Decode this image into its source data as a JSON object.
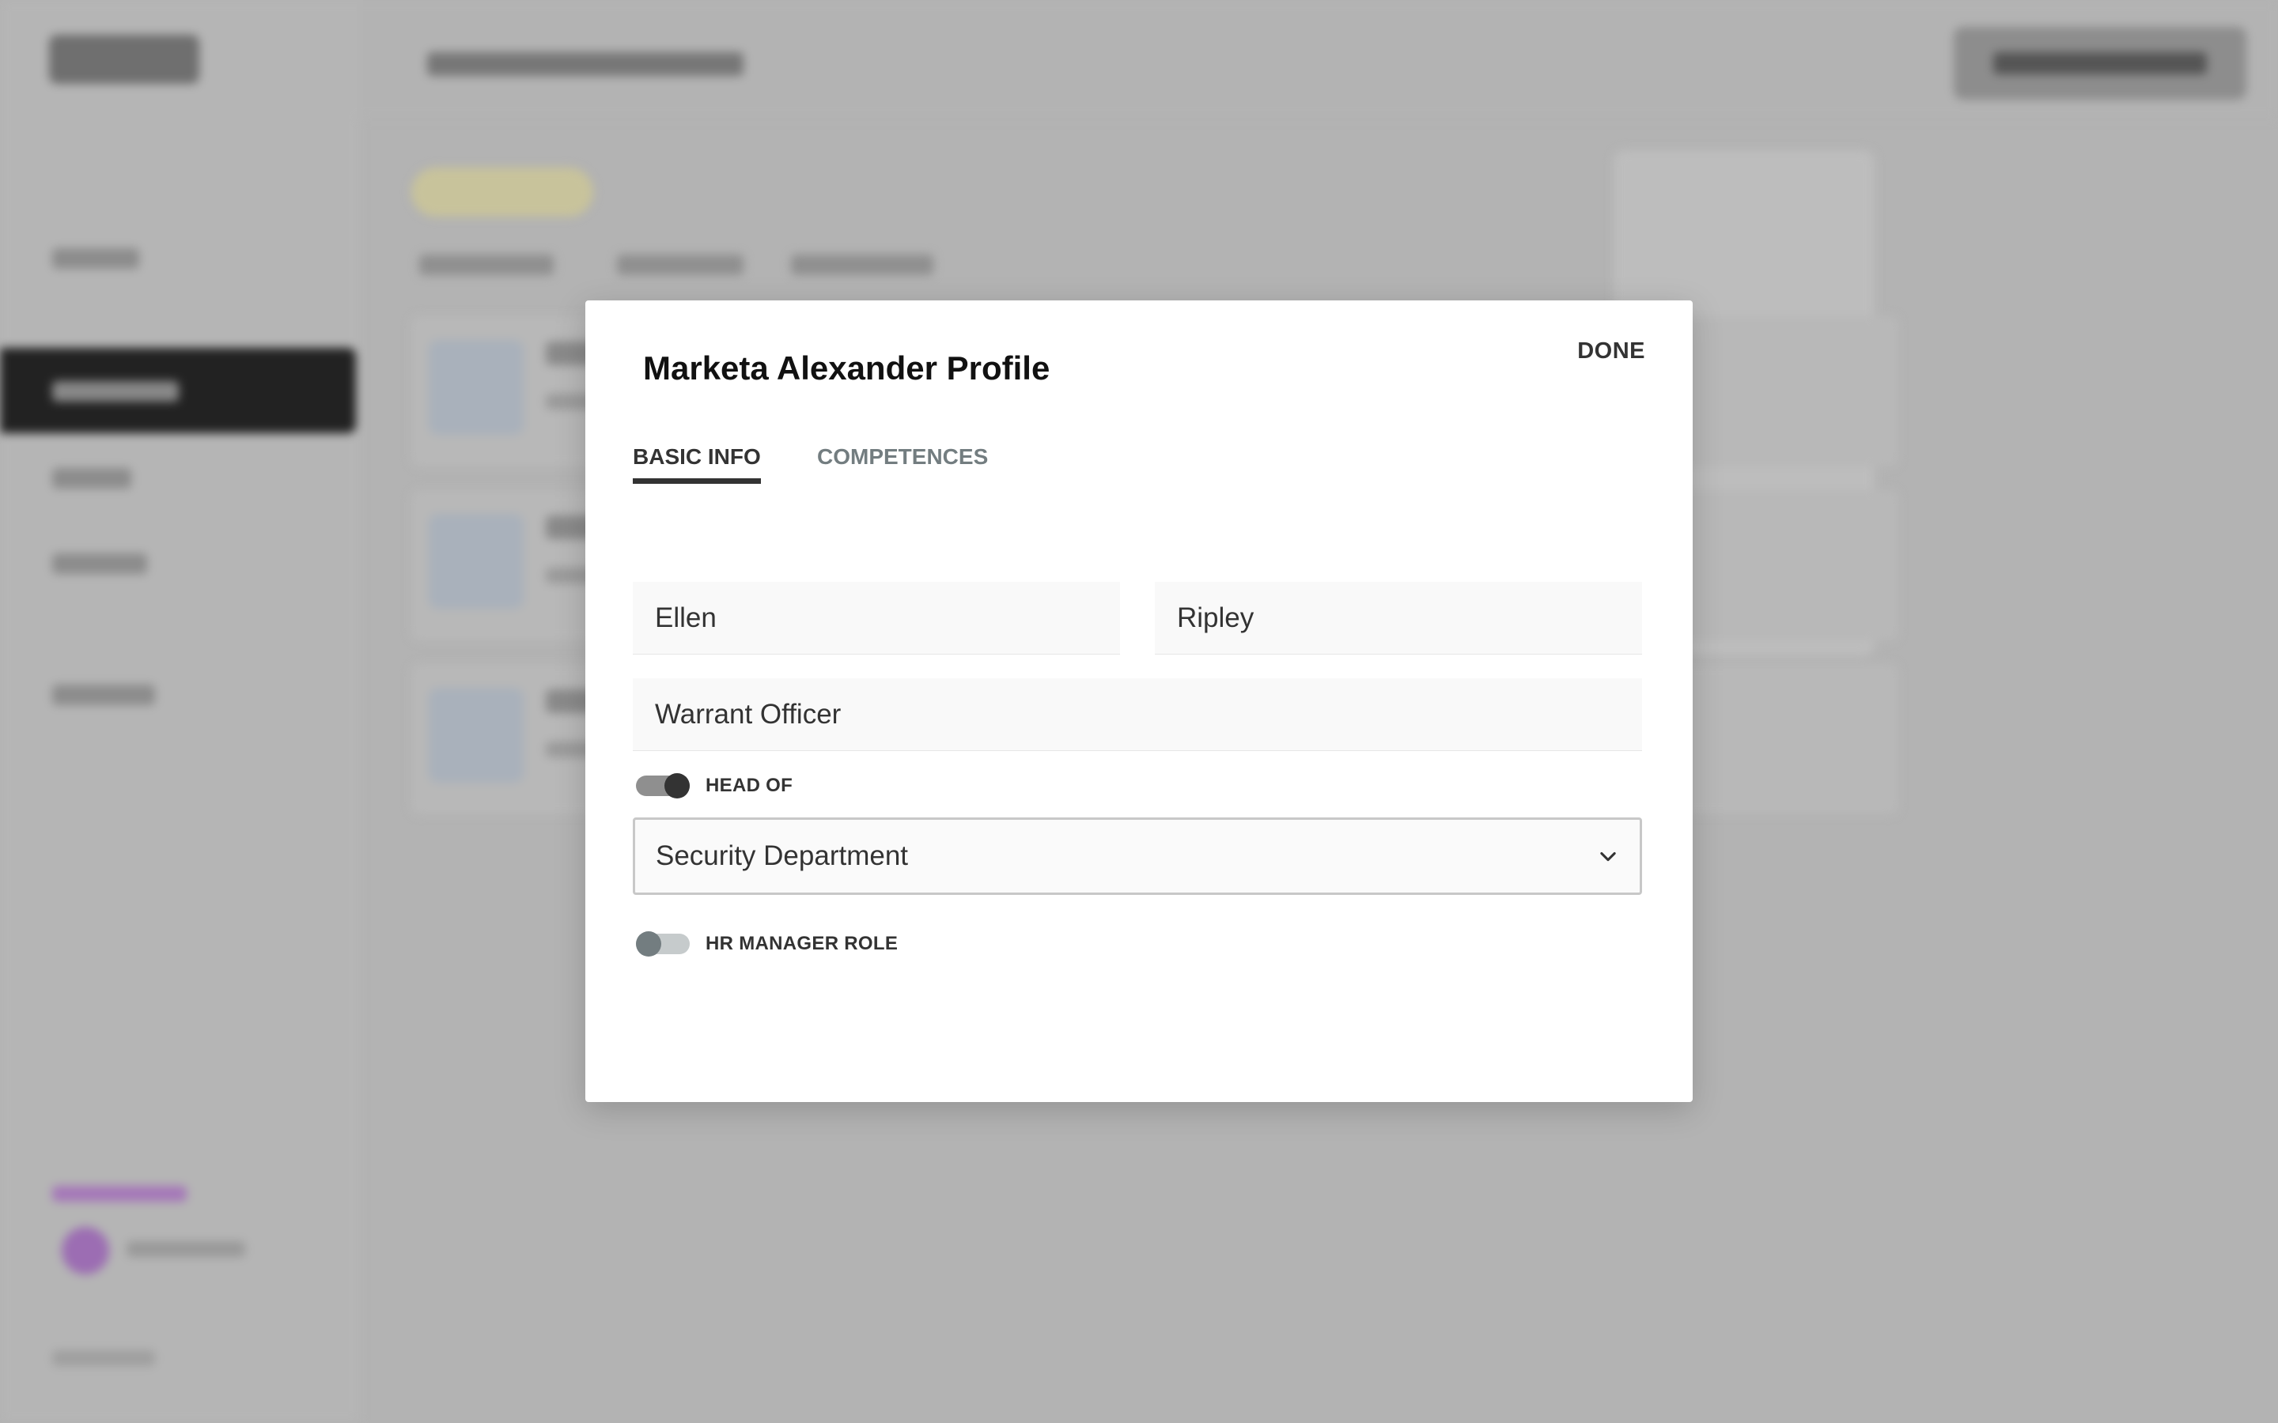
{
  "modal": {
    "title": "Marketa Alexander Profile",
    "done_label": "DONE",
    "tabs": [
      {
        "label": "BASIC INFO",
        "active": true
      },
      {
        "label": "COMPETENCES",
        "active": false
      }
    ],
    "fields": {
      "first_name": "Ellen",
      "last_name": "Ripley",
      "job_title": "Warrant Officer"
    },
    "head_of": {
      "label": "HEAD OF",
      "enabled": true
    },
    "department": {
      "value": "Security Department"
    },
    "hr_manager_role": {
      "label": "HR MANAGER ROLE",
      "enabled": false
    }
  },
  "icons": {
    "dropdown": "chevron-down-icon"
  },
  "colors": {
    "overlay": "#b3b3b3",
    "modal_bg": "#ffffff",
    "active_tab": "#333333",
    "inactive_tab": "#737d80",
    "toggle_on_knob": "#333333",
    "toggle_off_knob": "#737d80",
    "field_bg": "#f9f9f9"
  }
}
